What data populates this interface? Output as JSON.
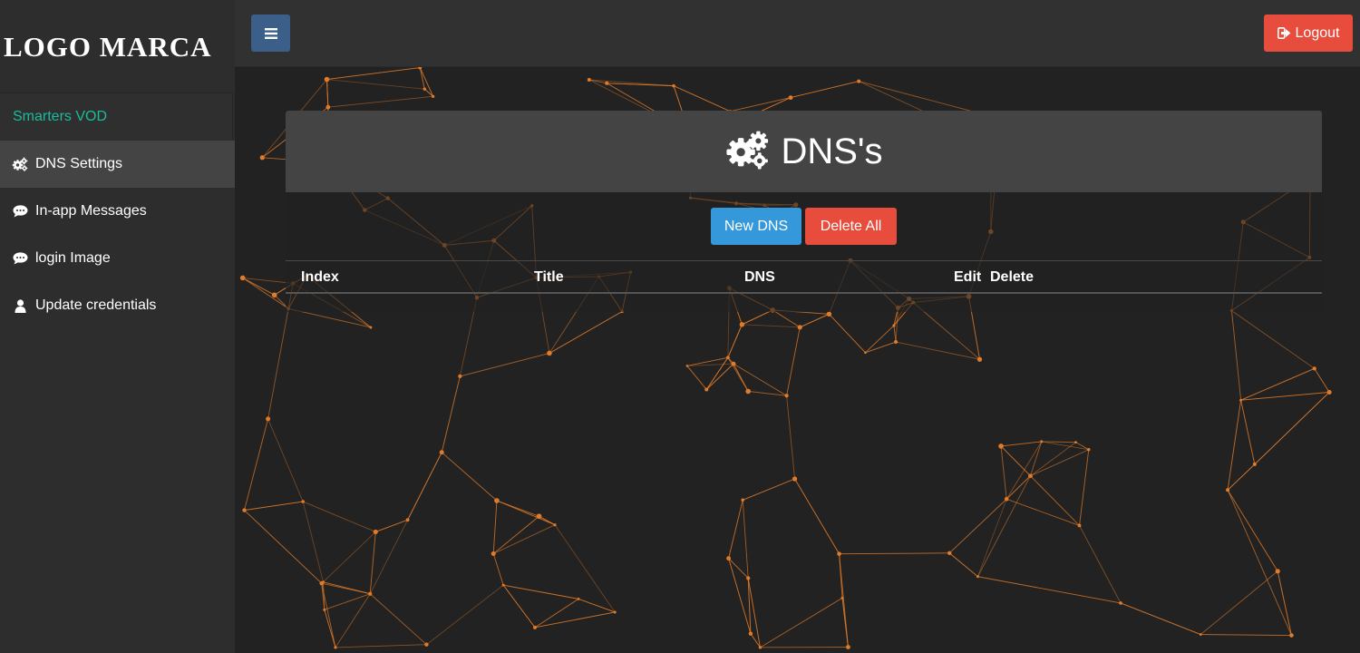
{
  "sidebar": {
    "logo": "LOGO MARCA",
    "brand": "Smarters VOD",
    "items": [
      {
        "label": "DNS Settings",
        "icon": "gears-icon",
        "active": true
      },
      {
        "label": "In-app Messages",
        "icon": "comment-icon",
        "active": false
      },
      {
        "label": "login Image",
        "icon": "comment-icon",
        "active": false
      },
      {
        "label": "Update credentials",
        "icon": "user-icon",
        "active": false
      }
    ]
  },
  "header": {
    "menu_icon": "hamburger-icon",
    "logout_label": "Logout",
    "logout_icon": "sign-out-icon"
  },
  "main": {
    "title": "DNS's",
    "title_icon": "gears-icon",
    "new_button": "New DNS",
    "delete_all_button": "Delete All",
    "table": {
      "columns": [
        "Index",
        "Title",
        "DNS",
        "Edit",
        "Delete"
      ],
      "rows": []
    }
  },
  "colors": {
    "accent_green": "#1abc9c",
    "primary_blue": "#3498db",
    "danger_red": "#e74c3c",
    "menu_blue": "#3b5f89",
    "network_orange": "#e07b2a"
  }
}
